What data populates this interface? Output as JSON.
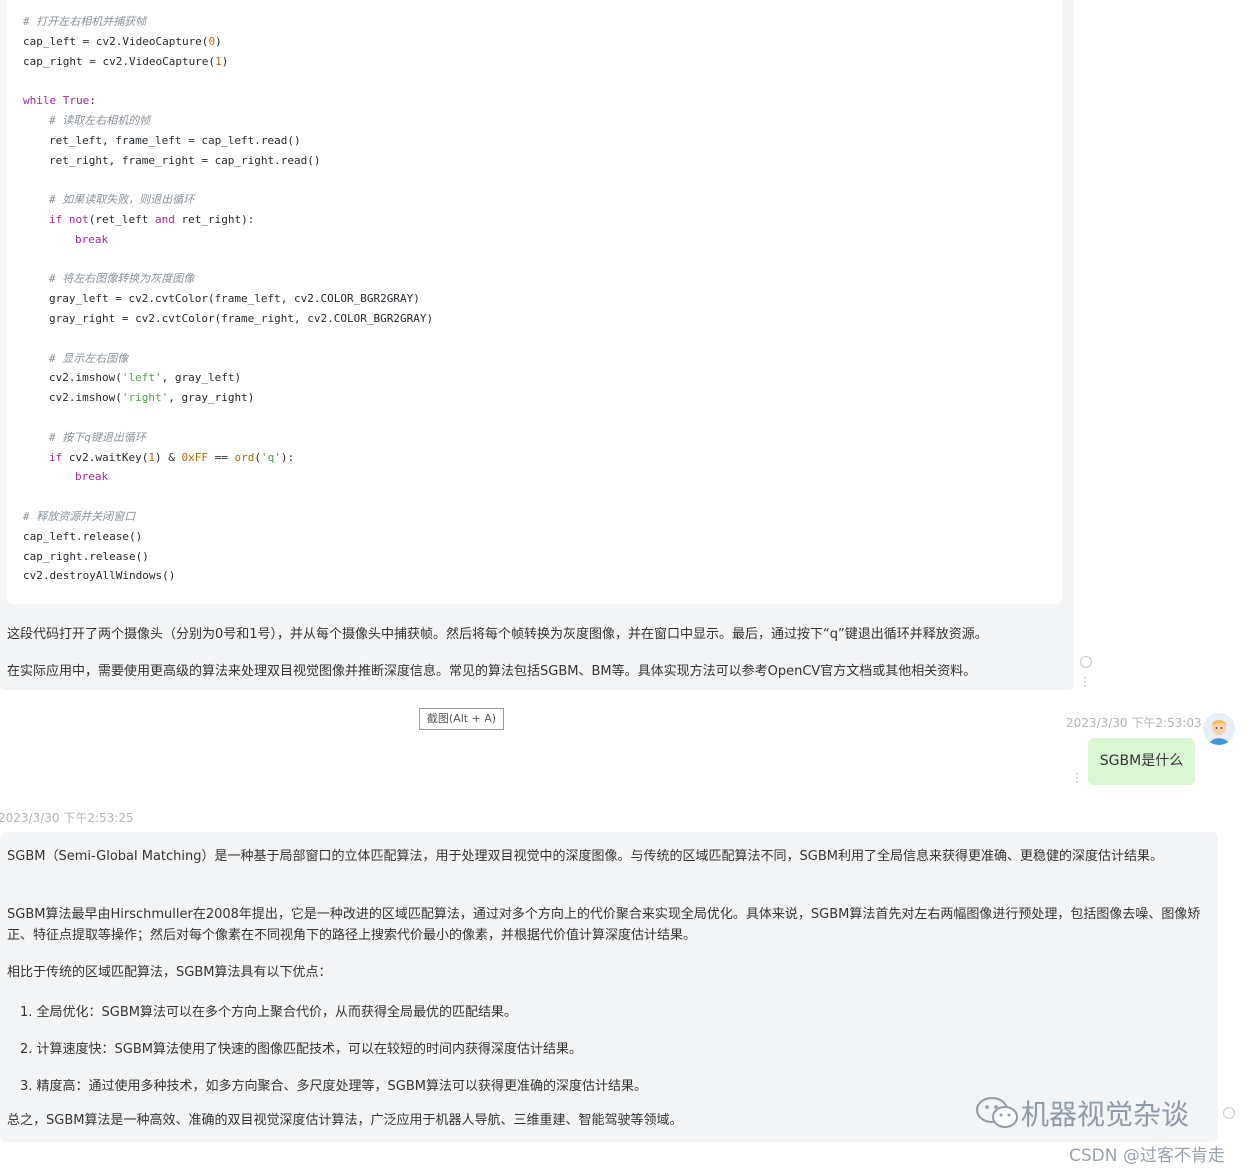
{
  "code_lines": [
    {
      "t": "# 打开左右相机并捕获帧",
      "cls": "c",
      "indent": 0
    },
    {
      "t": "cap_left = cv2.VideoCapture(0)",
      "cls": "",
      "indent": 0
    },
    {
      "t": "cap_right = cv2.VideoCapture(1)",
      "cls": "",
      "indent": 0
    },
    {
      "t": "",
      "cls": "",
      "indent": 0
    },
    {
      "t": "while True:",
      "cls": "kw",
      "indent": 0
    },
    {
      "t": "# 读取左右相机的帧",
      "cls": "c",
      "indent": 1
    },
    {
      "t": "ret_left, frame_left = cap_left.read()",
      "cls": "",
      "indent": 1
    },
    {
      "t": "ret_right, frame_right = cap_right.read()",
      "cls": "",
      "indent": 1
    },
    {
      "t": "",
      "cls": "",
      "indent": 0
    },
    {
      "t": "# 如果读取失败，则退出循环",
      "cls": "c",
      "indent": 1
    },
    {
      "t": "if not(ret_left and ret_right):",
      "cls": "if",
      "indent": 1
    },
    {
      "t": "break",
      "cls": "k",
      "indent": 2
    },
    {
      "t": "",
      "cls": "",
      "indent": 0
    },
    {
      "t": "# 将左右图像转换为灰度图像",
      "cls": "c",
      "indent": 1
    },
    {
      "t": "gray_left = cv2.cvtColor(frame_left, cv2.COLOR_BGR2GRAY)",
      "cls": "",
      "indent": 1
    },
    {
      "t": "gray_right = cv2.cvtColor(frame_right, cv2.COLOR_BGR2GRAY)",
      "cls": "",
      "indent": 1
    },
    {
      "t": "",
      "cls": "",
      "indent": 0
    },
    {
      "t": "# 显示左右图像",
      "cls": "c",
      "indent": 1
    },
    {
      "t": "cv2.imshow('left', gray_left)",
      "cls": "str",
      "indent": 1
    },
    {
      "t": "cv2.imshow('right', gray_right)",
      "cls": "str",
      "indent": 1
    },
    {
      "t": "",
      "cls": "",
      "indent": 0
    },
    {
      "t": "# 按下q键退出循环",
      "cls": "c",
      "indent": 1
    },
    {
      "t": "if cv2.waitKey(1) & 0xFF == ord('q'):",
      "cls": "if2",
      "indent": 1
    },
    {
      "t": "break",
      "cls": "k",
      "indent": 2
    },
    {
      "t": "",
      "cls": "",
      "indent": 0
    },
    {
      "t": "# 释放资源并关闭窗口",
      "cls": "c",
      "indent": 0
    },
    {
      "t": "cap_left.release()",
      "cls": "",
      "indent": 0
    },
    {
      "t": "cap_right.release()",
      "cls": "",
      "indent": 0
    },
    {
      "t": "cv2.destroyAllWindows()",
      "cls": "",
      "indent": 0
    }
  ],
  "answer1": {
    "p1": "这段代码打开了两个摄像头（分别为0号和1号），并从每个摄像头中捕获帧。然后将每个帧转换为灰度图像，并在窗口中显示。最后，通过按下“q”键退出循环并释放资源。",
    "p2": "在实际应用中，需要使用更高级的算法来处理双目视觉图像并推断深度信息。常见的算法包括SGBM、BM等。具体实现方法可以参考OpenCV官方文档或其他相关资料。"
  },
  "screenshot_button": "截图(Alt + A)",
  "user_msg": {
    "timestamp": "2023/3/30 下午2:53:03",
    "text": "SGBM是什么"
  },
  "answer2": {
    "timestamp": "2023/3/30 下午2:53:25",
    "p1": "SGBM（Semi-Global Matching）是一种基于局部窗口的立体匹配算法，用于处理双目视觉中的深度图像。与传统的区域匹配算法不同，SGBM利用了全局信息来获得更准确、更稳健的深度估计结果。",
    "p2": "SGBM算法最早由Hirschmuller在2008年提出，它是一种改进的区域匹配算法，通过对多个方向上的代价聚合来实现全局优化。具体来说，SGBM算法首先对左右两幅图像进行预处理，包括图像去噪、图像矫正、特征点提取等操作；然后对每个像素在不同视角下的路径上搜索代价最小的像素，并根据代价值计算深度估计结果。",
    "p3": "相比于传统的区域匹配算法，SGBM算法具有以下优点：",
    "li1": "1. 全局优化：SGBM算法可以在多个方向上聚合代价，从而获得全局最优的匹配结果。",
    "li2": "2. 计算速度快：SGBM算法使用了快速的图像匹配技术，可以在较短的时间内获得深度估计结果。",
    "li3": "3. 精度高：通过使用多种技术，如多方向聚合、多尺度处理等，SGBM算法可以获得更准确的深度估计结果。",
    "p4": "总之，SGBM算法是一种高效、准确的双目视觉深度估计算法，广泛应用于机器人导航、三维重建、智能驾驶等领域。"
  },
  "watermark": {
    "line1": "机器视觉杂谈",
    "line2": "CSDN @过客不肯走"
  },
  "icons": [
    "wechat-icon",
    "more-dots-icon",
    "status-circle-icon",
    "avatar-icon"
  ]
}
